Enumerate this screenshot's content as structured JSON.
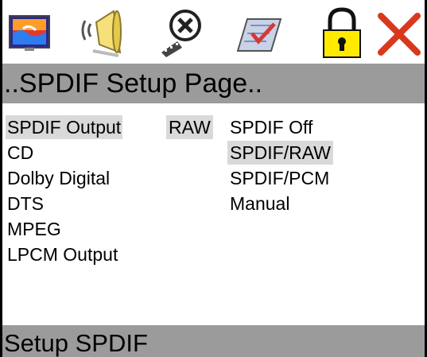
{
  "toolbar": {
    "icons": [
      {
        "name": "picture-settings-icon"
      },
      {
        "name": "audio-settings-icon"
      },
      {
        "name": "film-settings-icon"
      },
      {
        "name": "preferences-icon"
      },
      {
        "name": "lock-icon"
      },
      {
        "name": "exit-icon"
      }
    ]
  },
  "page_title": "..SPDIF Setup Page..",
  "menu": {
    "items": [
      {
        "label": "SPDIF Output"
      },
      {
        "label": "CD"
      },
      {
        "label": "Dolby Digital"
      },
      {
        "label": "DTS"
      },
      {
        "label": "MPEG"
      },
      {
        "label": "LPCM Output"
      }
    ],
    "current_value": "RAW"
  },
  "options": [
    {
      "label": "SPDIF Off"
    },
    {
      "label": "SPDIF/RAW"
    },
    {
      "label": "SPDIF/PCM"
    },
    {
      "label": "Manual"
    }
  ],
  "status": "Setup SPDIF",
  "colors": {
    "bar_gray": "#9b9b9b",
    "highlight": "#d9d9d9",
    "exit_red": "#d9381e",
    "lock_yellow": "#ffea00"
  }
}
